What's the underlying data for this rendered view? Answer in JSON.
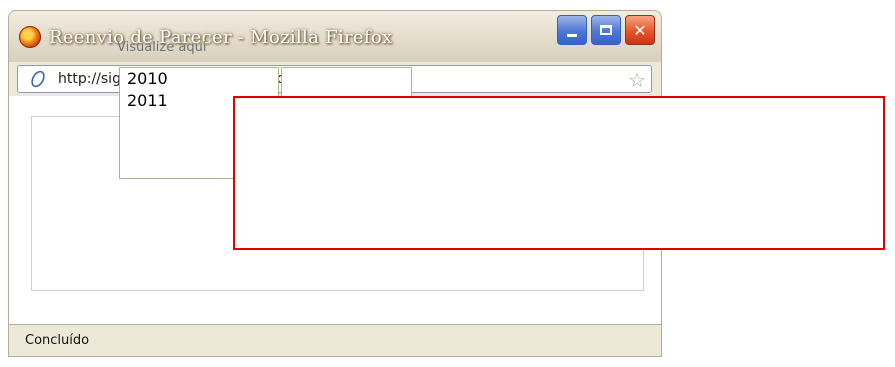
{
  "window": {
    "title": "Reenvio de Parecer - Mozilla Firefox",
    "app_icon": "firefox-icon",
    "controls": {
      "minimize": "minimize-icon",
      "maximize": "maximize-icon",
      "close_glyph": "✕"
    }
  },
  "address_bar": {
    "url": "http://sigproj.mec.gov.br/avaliador/enviados.php",
    "bookmark_glyph": "☆"
  },
  "content": {
    "hint": "Visualize aqui",
    "year_list": {
      "options": [
        "2010",
        "2011"
      ]
    },
    "second_list": {
      "options": []
    }
  },
  "status": {
    "text": "Concluído"
  },
  "colors": {
    "overlay_border": "#e00000",
    "titlebar": "#e6dfcf",
    "chrome": "#ece9d8"
  }
}
